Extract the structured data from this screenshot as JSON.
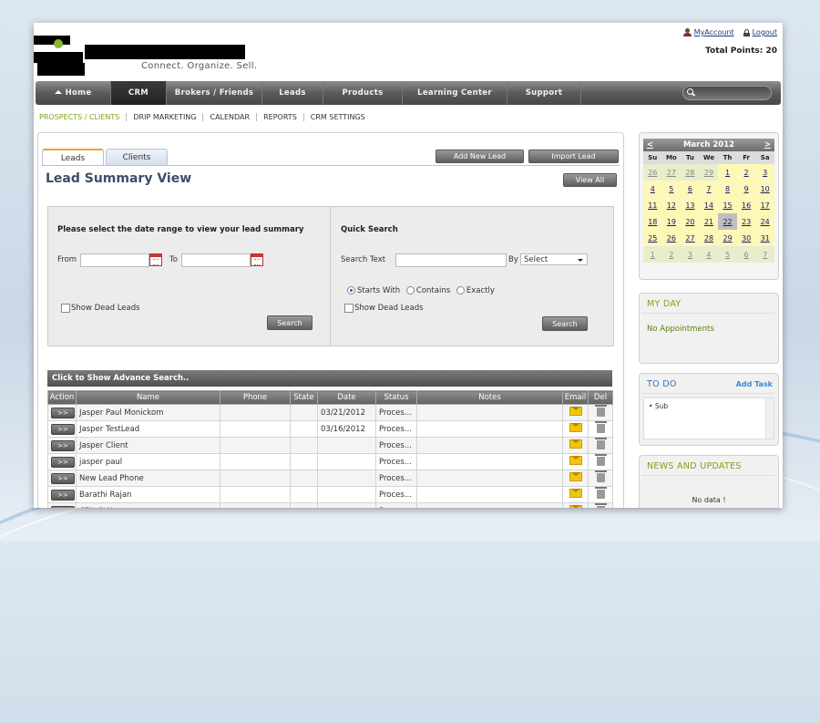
{
  "header": {
    "tagline": "Connect. Organize. Sell.",
    "my_account": "MyAccount",
    "logout": "Logout",
    "total_points": "Total Points: 20"
  },
  "nav": {
    "items": [
      "Home",
      "CRM",
      "Brokers / Friends",
      "Leads",
      "Products",
      "Learning Center",
      "Support"
    ]
  },
  "subnav": {
    "items": [
      "PROSPECTS / CLIENTS",
      "DRIP MARKETING",
      "CALENDAR",
      "REPORTS",
      "CRM SETTINGS"
    ]
  },
  "tabs": {
    "leads": "Leads",
    "clients": "Clients"
  },
  "actions": {
    "add_new_lead": "Add New Lead",
    "import_lead": "Import Lead",
    "view_all": "View All"
  },
  "page_title": "Lead Summary View",
  "date_filter": {
    "heading": "Please select the date range to view your lead summary",
    "from_label": "From",
    "to_label": "To",
    "show_dead": "Show Dead Leads",
    "search": "Search"
  },
  "quick_search": {
    "heading": "Quick Search",
    "text_label": "Search Text",
    "by_label": "By",
    "by_value": "Select",
    "starts_with": "Starts With",
    "contains": "Contains",
    "exactly": "Exactly",
    "show_dead": "Show Dead Leads",
    "search": "Search"
  },
  "advance_search": "Click to Show Advance Search..",
  "table": {
    "headers": [
      "Action",
      "Name",
      "Phone",
      "State",
      "Date",
      "Status",
      "Notes",
      "Email",
      "Del"
    ],
    "action_label": ">>",
    "rows": [
      {
        "name": "Jasper Paul Monickom",
        "phone": "",
        "state": "",
        "date": "03/21/2012",
        "status": "Proces..."
      },
      {
        "name": "Jasper TestLead",
        "phone": "",
        "state": "",
        "date": "03/16/2012",
        "status": "Proces..."
      },
      {
        "name": "Jasper Client",
        "phone": "",
        "state": "",
        "date": "",
        "status": "Proces..."
      },
      {
        "name": "jasper paul",
        "phone": "",
        "state": "",
        "date": "",
        "status": "Proces..."
      },
      {
        "name": "New Lead Phone",
        "phone": "",
        "state": "",
        "date": "",
        "status": "Proces..."
      },
      {
        "name": "Barathi Rajan",
        "phone": "",
        "state": "",
        "date": "",
        "status": "Proces..."
      },
      {
        "name": "CFN CLN",
        "phone": "",
        "state": "",
        "date": "",
        "status": "Proces..."
      }
    ]
  },
  "calendar": {
    "prev": "<",
    "next": ">",
    "month": "March 2012",
    "days": [
      "Su",
      "Mo",
      "Tu",
      "We",
      "Th",
      "Fr",
      "Sa"
    ],
    "weeks": [
      [
        "26",
        "27",
        "28",
        "29",
        "1",
        "2",
        "3"
      ],
      [
        "4",
        "5",
        "6",
        "7",
        "8",
        "9",
        "10"
      ],
      [
        "11",
        "12",
        "13",
        "14",
        "15",
        "16",
        "17"
      ],
      [
        "18",
        "19",
        "20",
        "21",
        "22",
        "23",
        "24"
      ],
      [
        "25",
        "26",
        "27",
        "28",
        "29",
        "30",
        "31"
      ],
      [
        "1",
        "2",
        "3",
        "4",
        "5",
        "6",
        "7"
      ]
    ]
  },
  "my_day": {
    "title": "MY DAY",
    "text": "No Appointments"
  },
  "todo": {
    "title": "TO DO",
    "add": "Add Task",
    "item": "Sub"
  },
  "news": {
    "title": "NEWS AND UPDATES",
    "text": "No data !"
  }
}
